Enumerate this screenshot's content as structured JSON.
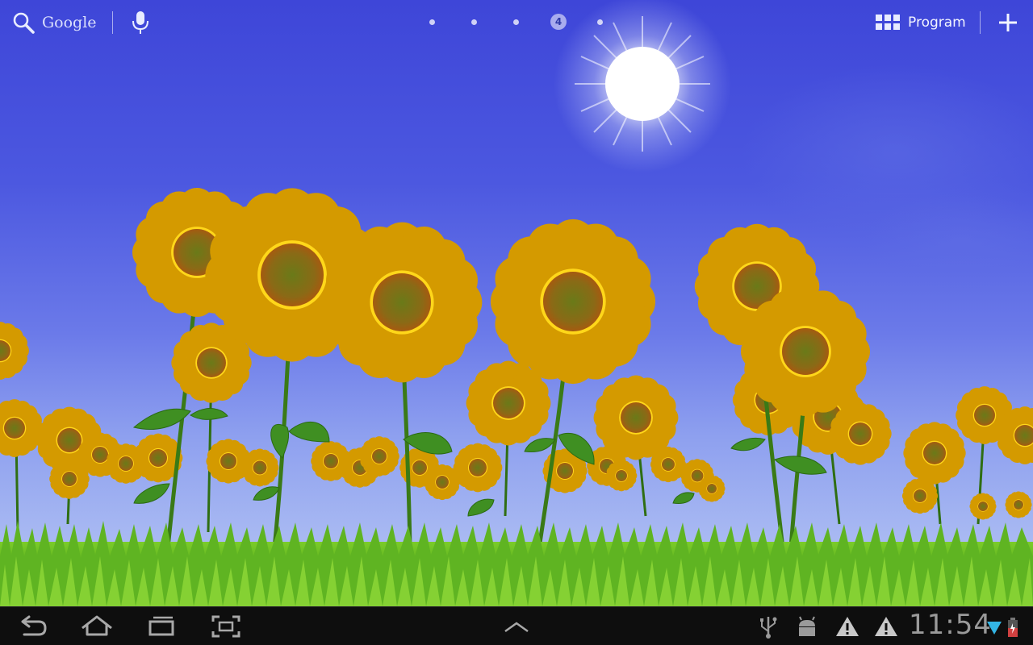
{
  "screen": "Android tablet home screen",
  "top_bar": {
    "search": {
      "label": "Google",
      "icon": "search-icon"
    },
    "voice_search": {
      "icon": "mic-icon"
    },
    "home_pages": {
      "count": 5,
      "current_index": 4,
      "current_label": "4"
    },
    "apps_button": {
      "label": "Program",
      "icon": "apps-grid-icon"
    },
    "add_button": {
      "icon": "plus-icon"
    }
  },
  "wallpaper": {
    "type": "live-wallpaper",
    "scene": "sunflower field",
    "colors": {
      "sky": "#4a55dd",
      "sunflower_petal": "#f2c400",
      "grass": "#4fa61a"
    }
  },
  "system_bar": {
    "nav": {
      "back_icon": "back-icon",
      "home_icon": "home-icon",
      "recents_icon": "recent-apps-icon",
      "screenshot_icon": "screenshot-icon",
      "menu_icon": "chevron-up-icon"
    },
    "notifications": [
      "usb-icon",
      "android-debug-icon",
      "warning-icon",
      "warning-icon"
    ],
    "clock": "11:54",
    "status_icons": [
      "wifi-icon",
      "battery-icon"
    ]
  }
}
